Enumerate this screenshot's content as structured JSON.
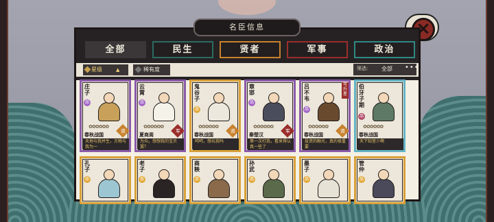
{
  "header": {
    "title": "名臣信息"
  },
  "tabs": [
    {
      "label": "全部",
      "key": "all"
    },
    {
      "label": "民生",
      "key": "min"
    },
    {
      "label": "贤者",
      "key": "xian"
    },
    {
      "label": "军事",
      "key": "jun"
    },
    {
      "label": "政治",
      "key": "zheng"
    }
  ],
  "filters": {
    "sort_label": "星级",
    "rarity_label": "稀有度",
    "filter_label": "筛选:",
    "filter_value": "全部",
    "more": "•••"
  },
  "colors": {
    "purple": "#8a5aa8",
    "gold": "#d9a13a",
    "blue": "#63b3c4",
    "xian": "#c9822e",
    "jun": "#9a2e2b"
  },
  "cards_row1": [
    {
      "name": "庄子",
      "era": "春秋战国",
      "badge": "贤",
      "quote": "天地与我并生，万物与我为一",
      "stars": "✿✿✿✿✿✿"
    },
    {
      "name": "云霄",
      "era": "夏商周",
      "badge": "军",
      "quote": "为众。想想我的宝贝罢？",
      "stars": "✿✿✿✿✿✿"
    },
    {
      "name": "鬼谷子",
      "era": "春秋战国",
      "badge": "贤",
      "quote": "呵呵，想坑我吗",
      "stars": "✿✿✿✿✿✿"
    },
    {
      "name": "章邯",
      "era": "秦楚汉",
      "badge": "军",
      "quote": "第一次打我，看来得认真一些了",
      "stars": "✿✿✿✿✿✿"
    },
    {
      "name": "吕不韦",
      "era": "春秋战国",
      "badge": "贤",
      "quote": "投资的眼光，真的很重要",
      "stars": "✿✿✿✿✿✿",
      "tag": "可升星"
    },
    {
      "name": "伯牙子期",
      "era": "春秋战国",
      "badge": "",
      "quote": "天下知音少啊",
      "stars": "✿✿✿✿✿✿"
    }
  ],
  "cards_row2": [
    {
      "name": "孔子"
    },
    {
      "name": "老子"
    },
    {
      "name": "商鞅"
    },
    {
      "name": "孙武"
    },
    {
      "name": "墨子"
    },
    {
      "name": "管仲"
    }
  ]
}
